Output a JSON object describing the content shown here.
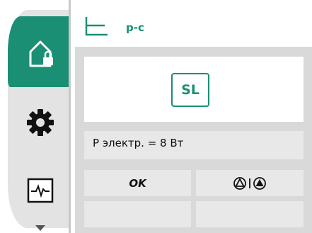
{
  "header": {
    "title": "p-c",
    "mode_icon": "constant-pressure-curve-icon"
  },
  "sidebar": {
    "items": [
      {
        "name": "home-lock",
        "icon": "home-lock-icon",
        "active": true
      },
      {
        "name": "settings",
        "icon": "gear-icon",
        "active": false
      },
      {
        "name": "diagnostics",
        "icon": "heartbeat-monitor-icon",
        "active": false
      },
      {
        "name": "more",
        "icon": "chevron-down-icon",
        "active": false
      }
    ]
  },
  "main": {
    "mode_badge": "SL",
    "power_text": "P электр. = 8 Вт",
    "ok_label": "OK",
    "pump_icons": "pump-single-twin-icon"
  },
  "colors": {
    "accent": "#1a8f74",
    "panel": "#d9d9d9",
    "cell": "#e8e8e8",
    "sidebar": "#e3e3e3"
  }
}
